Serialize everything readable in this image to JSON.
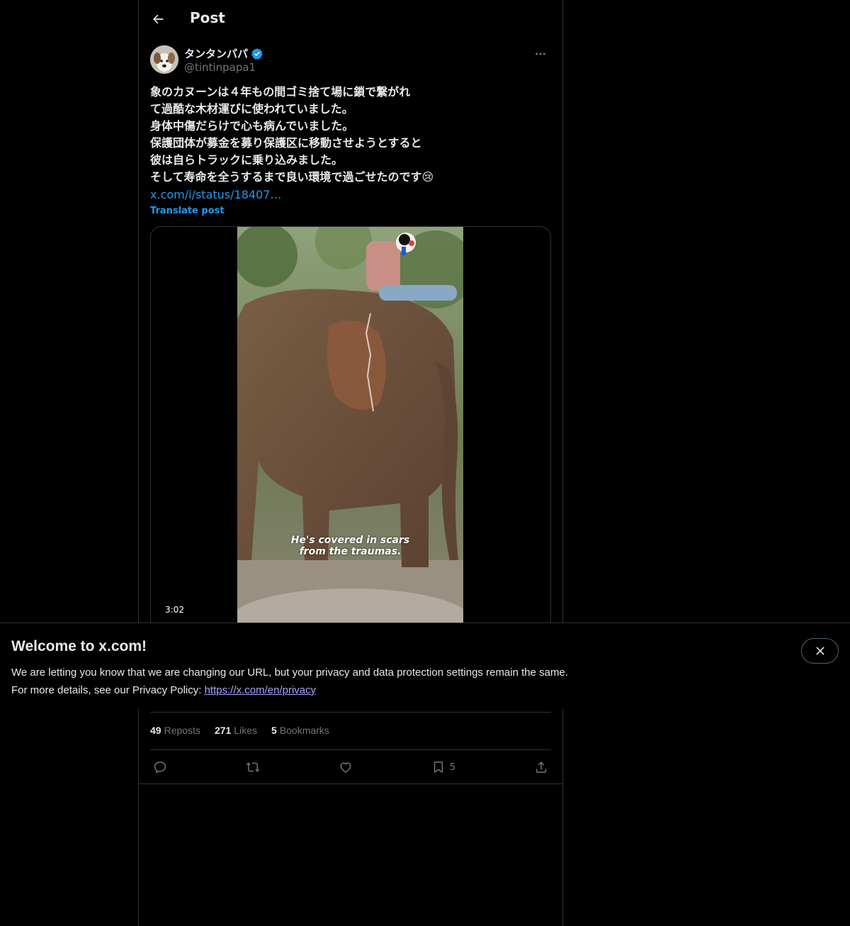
{
  "header": {
    "title": "Post"
  },
  "author": {
    "name": "タンタンパパ",
    "handle": "@tintinpapa1"
  },
  "post": {
    "lines": [
      "象のカヌーンは４年もの間ゴミ捨て場に鎖で繋がれ",
      "て過酷な木材運びに使われていました。",
      "身体中傷だらけで心も病んでいました。",
      "保護団体が募金を募り保護区に移動させようとすると",
      "彼は自らトラックに乗り込みました。",
      "そして寿命を全うするまで良い環境で過ごせたのです😢"
    ],
    "link": "x.com/i/status/18407…",
    "translate": "Translate post"
  },
  "media": {
    "duration": "3:02",
    "caption_line1": "He's covered in scars",
    "caption_line2": "from the traumas."
  },
  "stats": {
    "reposts_count": "49",
    "reposts_label": "Reposts",
    "likes_count": "271",
    "likes_label": "Likes",
    "bookmarks_count": "5",
    "bookmarks_label": "Bookmarks"
  },
  "actions": {
    "bookmark_count": "5"
  },
  "banner": {
    "title": "Welcome to x.com!",
    "line1": "We are letting you know that we are changing our URL, but your privacy and data protection settings remain the same.",
    "line2_prefix": "For more details, see our Privacy Policy: ",
    "link": "https://x.com/en/privacy"
  },
  "colors": {
    "background": "#000000",
    "text_primary": "#e7e9ea",
    "text_secondary": "#71767b",
    "accent": "#1d9bf0",
    "border": "#2f3336",
    "privacy_link": "#a8a4ff"
  }
}
